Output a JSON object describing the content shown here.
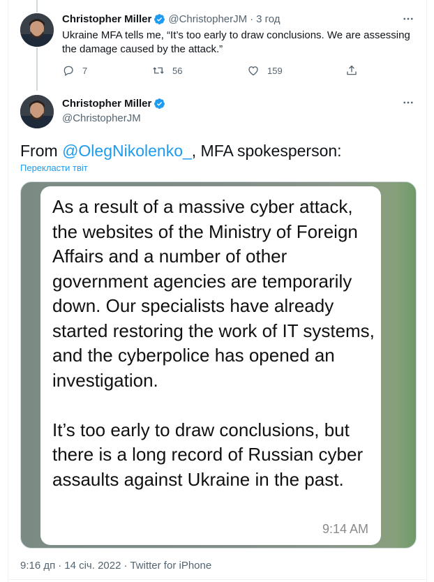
{
  "tweet1": {
    "author_name": "Christopher Miller",
    "handle": "@ChristopherJM",
    "separator": "·",
    "time": "3 год",
    "text": "Ukraine MFA tells me, “It’s too early to draw conclusions. We are assessing the damage caused by the attack.”",
    "actions": {
      "replies": "7",
      "retweets": "56",
      "likes": "159"
    }
  },
  "tweet2": {
    "author_name": "Christopher Miller",
    "handle": "@ChristopherJM",
    "text_prefix": "From ",
    "mention": "@OlegNikolenko_",
    "text_suffix": ", MFA spokesperson:",
    "translate_label": "Перекласти твіт",
    "image": {
      "message": "As a result of a massive cyber attack, the websites of the Ministry of Foreign Affairs and a number of other government agencies are temporarily down. Our specialists have already started restoring the work of IT systems, and the cyberpolice has opened an investigation.\n\nIt’s too early to draw conclusions, but there is a long record of Russian cyber assaults against Ukraine in the past.",
      "time": "9:14 AM"
    },
    "meta": {
      "time": "9:16 дп",
      "separator": "·",
      "date": "14 січ. 2022",
      "source": "Twitter for iPhone"
    }
  },
  "colors": {
    "accent": "#1d9bf0",
    "secondary_text": "#536471",
    "primary_text": "#0f1419"
  },
  "icons": {
    "more": "more-dots-icon",
    "reply": "reply-bubble-icon",
    "retweet": "retweet-icon",
    "like": "heart-icon",
    "share": "share-upload-icon",
    "verified": "verified-badge-icon"
  }
}
